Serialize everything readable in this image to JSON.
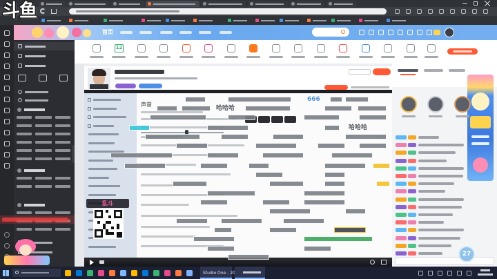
{
  "logo": "斗鱼",
  "header": {
    "nav_home": "首页"
  },
  "category_bar": {
    "calendar_day": "12"
  },
  "video": {
    "settings_title": "声音",
    "event_badge": "乱斗",
    "danmaku": [
      "666",
      "哈哈哈",
      "哈哈哈"
    ],
    "timer": "27"
  },
  "taskbar": {
    "app_label": "Studio One - 201..."
  },
  "icons": [
    "back-icon",
    "forward-icon",
    "refresh-icon",
    "search-icon",
    "calendar-icon",
    "qr-code-icon",
    "windows-start-icon",
    "avatar-icon"
  ],
  "colors": {
    "header_blue": "#6aa9ef",
    "accent_orange": "#ff5a33",
    "nav_dark": "#2c2d32",
    "taskbar": "#1b2033"
  }
}
